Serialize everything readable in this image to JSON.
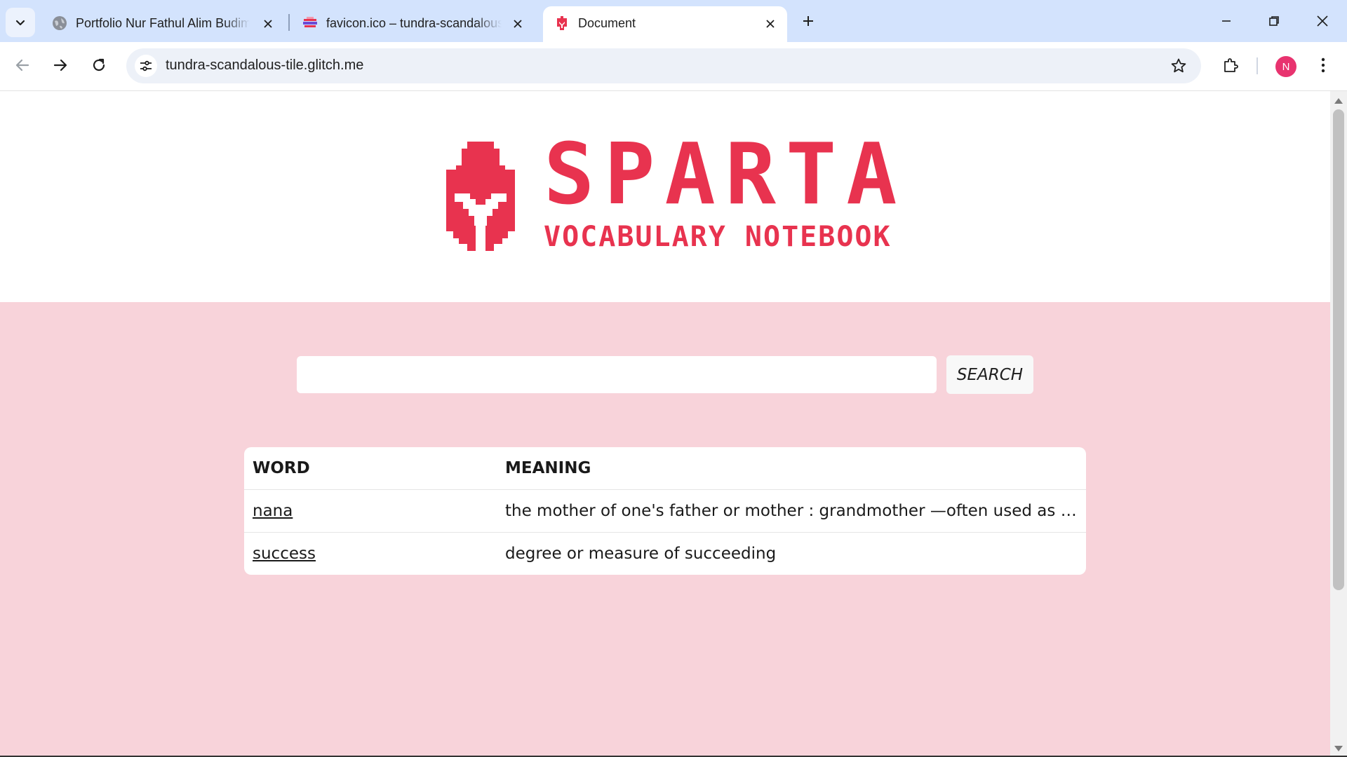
{
  "browser": {
    "tabs": [
      {
        "title": "Portfolio Nur Fathul Alim Budiman",
        "favicon": "globe-icon",
        "active": false
      },
      {
        "title": "favicon.ico – tundra-scandalous-tile",
        "favicon": "image-favicon",
        "active": false
      },
      {
        "title": "Document",
        "favicon": "sparta-helmet-favicon",
        "active": true
      }
    ],
    "url": "tundra-scandalous-tile.glitch.me",
    "profile_initial": "N"
  },
  "page": {
    "logo": {
      "title": "SPARTA",
      "subtitle": "VOCABULARY NOTEBOOK",
      "color": "#e8334f"
    },
    "search": {
      "value": "",
      "placeholder": "",
      "button_label": "SEARCH"
    },
    "table": {
      "headers": {
        "word": "WORD",
        "meaning": "MEANING"
      },
      "rows": [
        {
          "word": "nana",
          "meaning": "the mother of one's father or mother : grandmother —often used as a form of address"
        },
        {
          "word": "success",
          "meaning": "degree or measure of succeeding"
        }
      ]
    },
    "colors": {
      "background_pink": "#f8d3da",
      "accent": "#e8334f"
    }
  }
}
